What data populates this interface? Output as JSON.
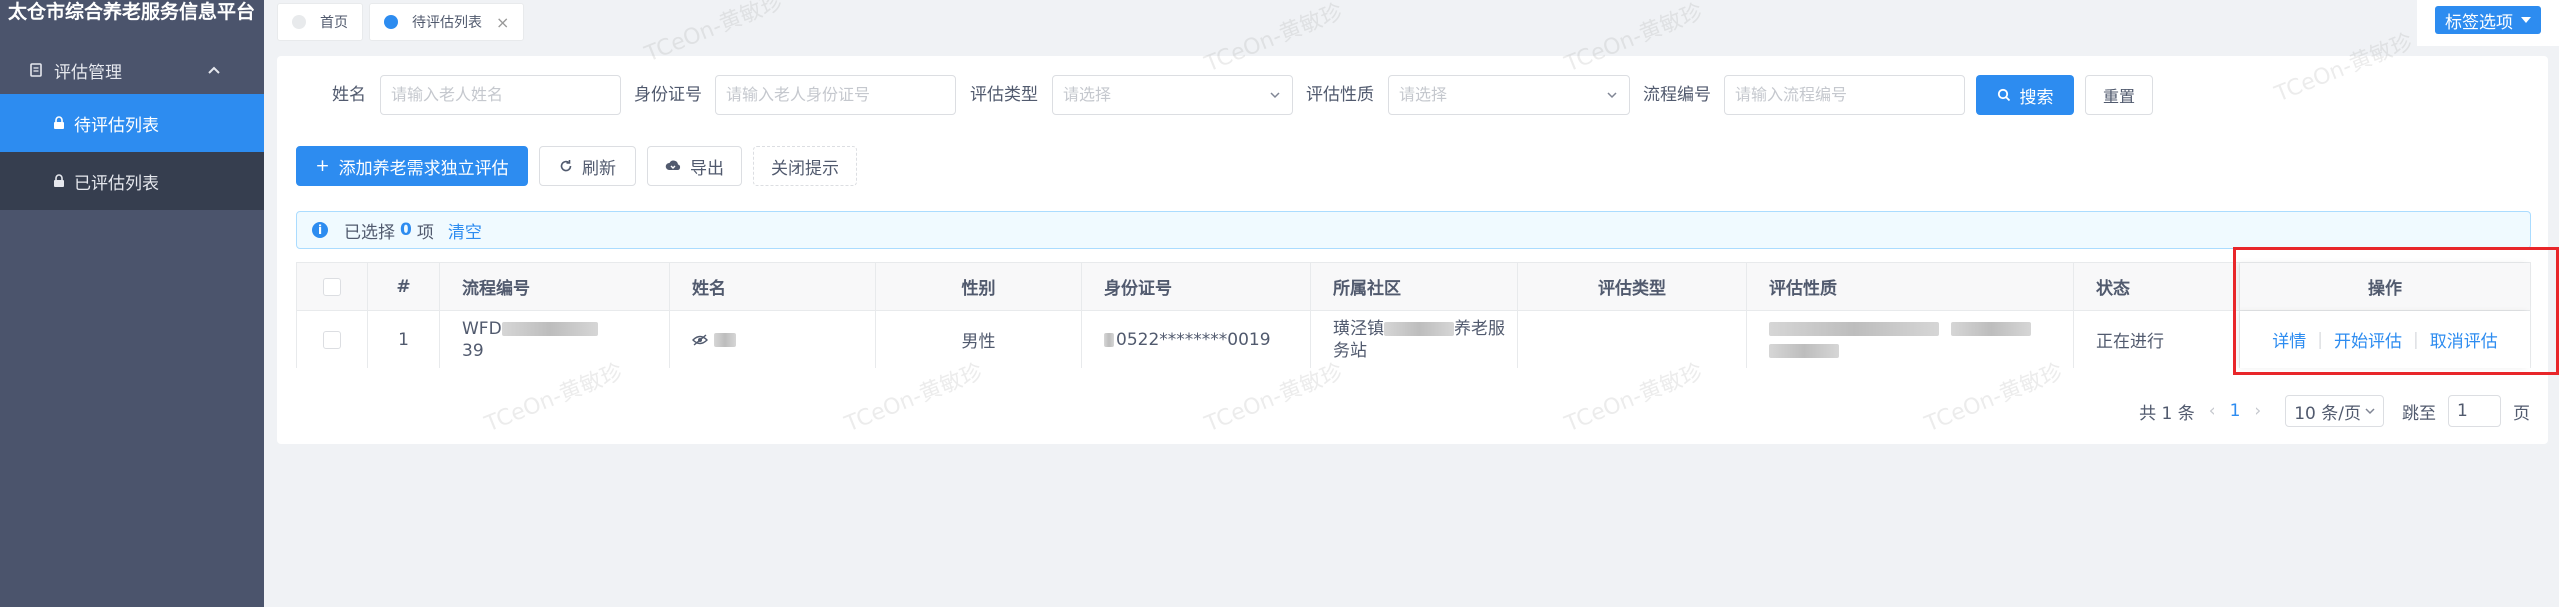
{
  "app": {
    "title": "太仓市综合养老服务信息平台"
  },
  "sidebar": {
    "group": {
      "label": "评估管理"
    },
    "items": [
      {
        "label": "待评估列表",
        "active": true
      },
      {
        "label": "已评估列表",
        "active": false
      }
    ]
  },
  "tabs": [
    {
      "label": "首页",
      "active": false
    },
    {
      "label": "待评估列表",
      "active": true,
      "close": "×"
    }
  ],
  "tag_options": {
    "label": "标签选项"
  },
  "filters": {
    "name": {
      "label": "姓名",
      "placeholder": "请输入老人姓名"
    },
    "idcard": {
      "label": "身份证号",
      "placeholder": "请输入老人身份证号"
    },
    "eval_type": {
      "label": "评估类型",
      "placeholder": "请选择"
    },
    "eval_nature": {
      "label": "评估性质",
      "placeholder": "请选择"
    },
    "process_no": {
      "label": "流程编号",
      "placeholder": "请输入流程编号"
    },
    "search_label": "搜索",
    "reset_label": "重置"
  },
  "actions": {
    "add_label": "添加养老需求独立评估",
    "refresh_label": "刷新",
    "export_label": "导出",
    "close_tip_label": "关闭提示"
  },
  "selection": {
    "prefix": "已选择",
    "count": "0",
    "suffix": "项",
    "clear": "清空"
  },
  "table": {
    "headers": [
      "#",
      "流程编号",
      "姓名",
      "性别",
      "身份证号",
      "所属社区",
      "评估类型",
      "评估性质",
      "状态",
      "操作"
    ],
    "rows": [
      {
        "index": "1",
        "process_no_line1": "WFD",
        "process_no_line2": "39",
        "name_suffix": " ",
        "gender": "男性",
        "idcard": "0522********0019",
        "community_line1": "璜泾镇",
        "community_mid": "养老服",
        "community_line2": "务站",
        "eval_type": "",
        "status": "正在进行",
        "ops": [
          "详情",
          "开始评估",
          "取消评估"
        ]
      }
    ]
  },
  "pagination": {
    "total": "共 1 条",
    "current": "1",
    "page_size": "10 条/页",
    "jump_label": "跳至",
    "jump_value": "1",
    "page_unit": "页"
  },
  "watermark": "TCeOn-黄敏珍",
  "colors": {
    "primary": "#2d8cf0",
    "sidebar": "#4b546c",
    "highlight": "#e8262a"
  }
}
